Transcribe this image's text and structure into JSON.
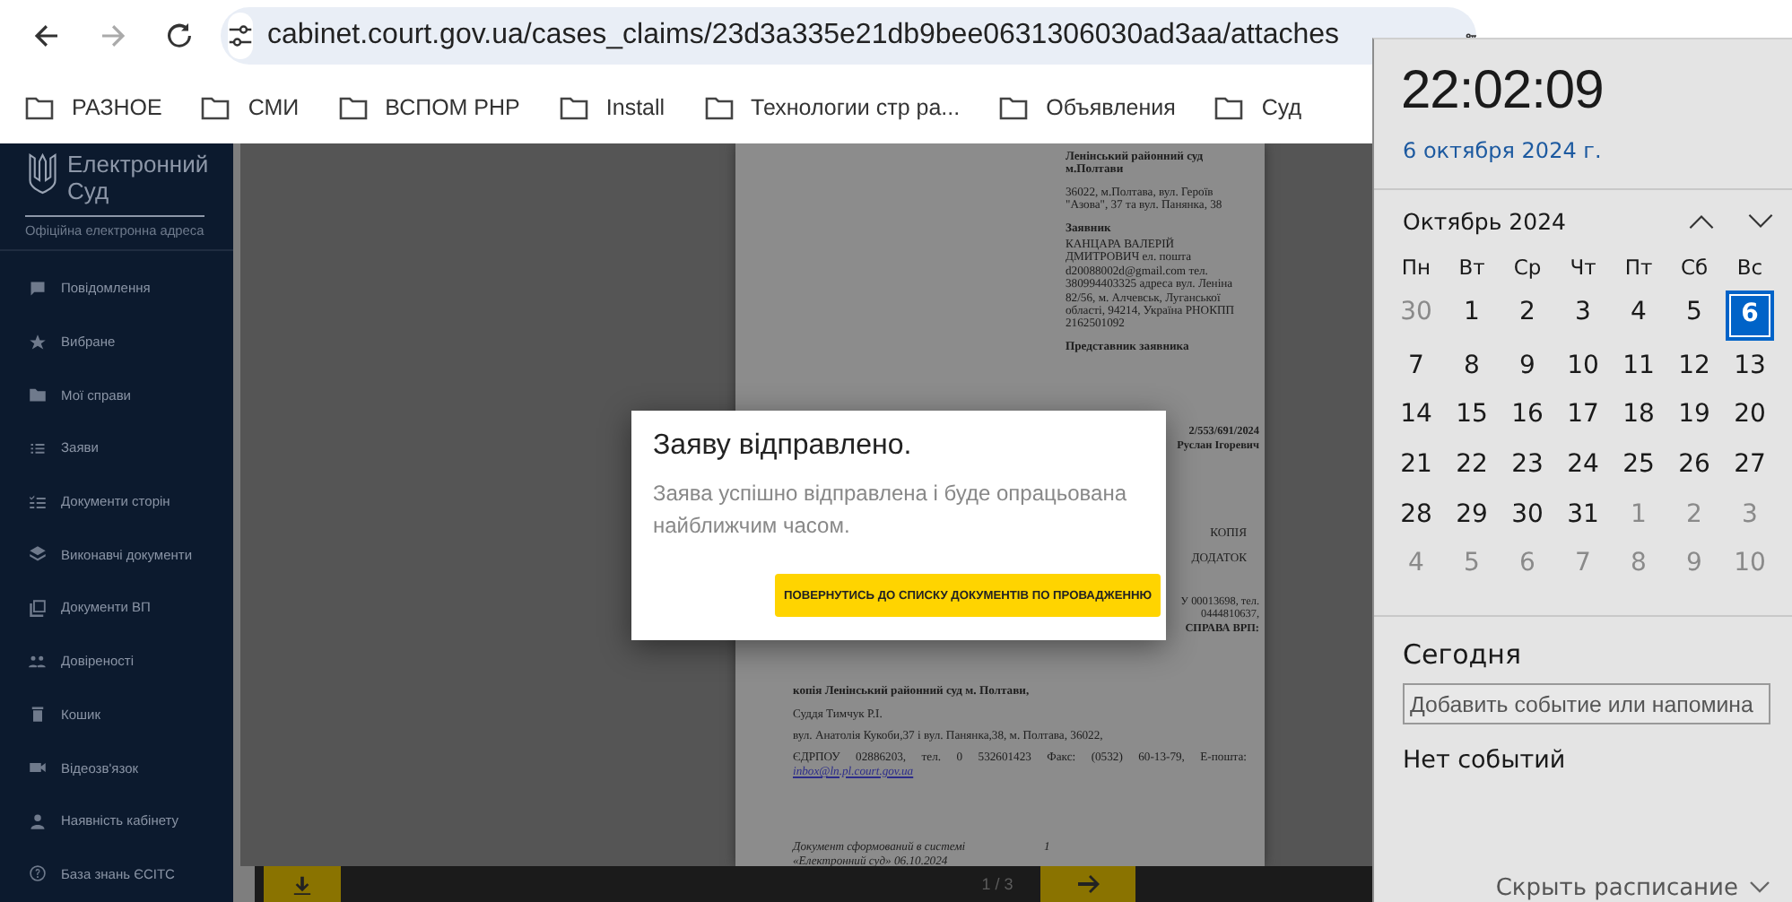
{
  "browser": {
    "url": "cabinet.court.gov.ua/cases_claims/23d3a335e21db9bee0631306030ad3aa/attaches",
    "forward_disabled": true,
    "bookmarks": [
      "РАЗНОЕ",
      "СМИ",
      "ВСПОМ PHP",
      "Install",
      "Технологии стр ра...",
      "Объявления",
      "Суд"
    ]
  },
  "sidebar": {
    "logo_title": "Електронний Суд",
    "subtitle": "Офіційна електронна адреса",
    "items": [
      "Повідомлення",
      "Вибране",
      "Мої справи",
      "Заяви",
      "Документи сторін",
      "Виконавчі документи",
      "Документи ВП",
      "Довіреності",
      "Кошик",
      "Відеозв'язок",
      "Наявність кабінету",
      "База знань ЄСІТС"
    ]
  },
  "document": {
    "header": [
      {
        "text": "Ленінський районний суд м.Полтави",
        "bold": true
      },
      {
        "text": "36022, м.Полтава, вул. Героїв \"Азова\", 37 та вул. Панянка, 38",
        "bold": false
      },
      {
        "text": "Заявник",
        "bold": true
      },
      {
        "text": "КАНЦАРА ВАЛЕРІЙ ДМИТРОВИЧ ел. пошта d20088002d@gmail.com тел. 380994403325 адреса вул. Леніна 82/56, м. Алчевськ, Луганської області, 94214, Україна РНОКПП 2162501092",
        "bold": false
      },
      {
        "text": "Представник заявника",
        "bold": true
      }
    ],
    "fragments": [
      "2/553/691/2024",
      "Руслан Ігоревич"
    ],
    "marks": [
      "КОПІЯ",
      "ДОДАТОК"
    ],
    "fragments_2": [
      "У 00013698, тел.",
      "0444810637,",
      "СПРАВА   ВРП:"
    ],
    "court_title": "копія Ленінський районний суд м. Полтави,",
    "judge": "Суддя Тимчук Р.І.",
    "address": "вул. Анатолія Кукоби,37 і вул. Панянка,38, м. Полтава, 36022,",
    "contacts": "ЄДРПОУ 02886203, тел. 0 532601423 Факс: (0532) 60-13-79, Е-пошта:",
    "email": "inbox@ln.pl.court.gov.ua",
    "footer": "Документ сформований в системі «Електронний суд» 06.10.2024",
    "footer_num": "1"
  },
  "pager": {
    "text": "1 / 3"
  },
  "modal": {
    "title": "Заяву відправлено.",
    "message": "Заява успішно відправлена і буде опрацьована найближчим часом.",
    "button": "ПОВЕРНУТИСЬ ДО СПИСКУ ДОКУМЕНТІВ ПО ПРОВАДЖЕННЮ"
  },
  "calendar": {
    "time": "22:02:09",
    "date": "6 октября 2024 г.",
    "month": "Октябрь 2024",
    "weekdays": [
      "Пн",
      "Вт",
      "Ср",
      "Чт",
      "Пт",
      "Сб",
      "Вс"
    ],
    "days": [
      {
        "label": "30",
        "muted": true,
        "selected": false
      },
      {
        "label": "1",
        "muted": false,
        "selected": false
      },
      {
        "label": "2",
        "muted": false,
        "selected": false
      },
      {
        "label": "3",
        "muted": false,
        "selected": false
      },
      {
        "label": "4",
        "muted": false,
        "selected": false
      },
      {
        "label": "5",
        "muted": false,
        "selected": false
      },
      {
        "label": "6",
        "muted": false,
        "selected": true
      },
      {
        "label": "7",
        "muted": false,
        "selected": false
      },
      {
        "label": "8",
        "muted": false,
        "selected": false
      },
      {
        "label": "9",
        "muted": false,
        "selected": false
      },
      {
        "label": "10",
        "muted": false,
        "selected": false
      },
      {
        "label": "11",
        "muted": false,
        "selected": false
      },
      {
        "label": "12",
        "muted": false,
        "selected": false
      },
      {
        "label": "13",
        "muted": false,
        "selected": false
      },
      {
        "label": "14",
        "muted": false,
        "selected": false
      },
      {
        "label": "15",
        "muted": false,
        "selected": false
      },
      {
        "label": "16",
        "muted": false,
        "selected": false
      },
      {
        "label": "17",
        "muted": false,
        "selected": false
      },
      {
        "label": "18",
        "muted": false,
        "selected": false
      },
      {
        "label": "19",
        "muted": false,
        "selected": false
      },
      {
        "label": "20",
        "muted": false,
        "selected": false
      },
      {
        "label": "21",
        "muted": false,
        "selected": false
      },
      {
        "label": "22",
        "muted": false,
        "selected": false
      },
      {
        "label": "23",
        "muted": false,
        "selected": false
      },
      {
        "label": "24",
        "muted": false,
        "selected": false
      },
      {
        "label": "25",
        "muted": false,
        "selected": false
      },
      {
        "label": "26",
        "muted": false,
        "selected": false
      },
      {
        "label": "27",
        "muted": false,
        "selected": false
      },
      {
        "label": "28",
        "muted": false,
        "selected": false
      },
      {
        "label": "29",
        "muted": false,
        "selected": false
      },
      {
        "label": "30",
        "muted": false,
        "selected": false
      },
      {
        "label": "31",
        "muted": false,
        "selected": false
      },
      {
        "label": "1",
        "muted": true,
        "selected": false
      },
      {
        "label": "2",
        "muted": true,
        "selected": false
      },
      {
        "label": "3",
        "muted": true,
        "selected": false
      },
      {
        "label": "4",
        "muted": true,
        "selected": false
      },
      {
        "label": "5",
        "muted": true,
        "selected": false
      },
      {
        "label": "6",
        "muted": true,
        "selected": false
      },
      {
        "label": "7",
        "muted": true,
        "selected": false
      },
      {
        "label": "8",
        "muted": true,
        "selected": false
      },
      {
        "label": "9",
        "muted": true,
        "selected": false
      },
      {
        "label": "10",
        "muted": true,
        "selected": false
      }
    ],
    "today_label": "Сегодня",
    "event_placeholder": "Добавить событие или напомина",
    "no_events": "Нет событий",
    "hide_link": "Скрыть расписание"
  }
}
